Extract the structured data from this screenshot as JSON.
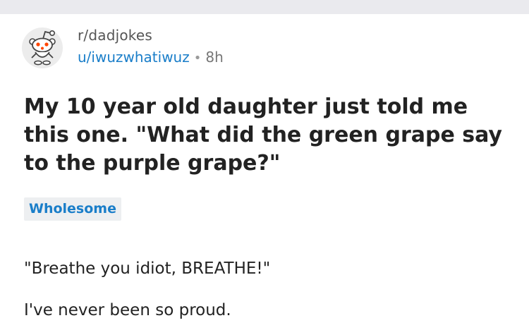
{
  "post": {
    "subreddit": "r/dadjokes",
    "username": "u/iwuzwhatiwuz",
    "separator": "•",
    "age": "8h",
    "title": "My 10 year old daughter just told me this one. \"What did the green grape say to the purple grape?\"",
    "flair": "Wholesome",
    "body": [
      "\"Breathe you idiot, BREATHE!\"",
      "I've never been so proud."
    ]
  },
  "colors": {
    "link_blue": "#1a7ec9",
    "top_bar_gray": "#eaeaee",
    "flair_bg": "#edeff1",
    "text_dark": "#222222"
  },
  "icons": {
    "avatar": "reddit-snoo-avatar-icon"
  }
}
